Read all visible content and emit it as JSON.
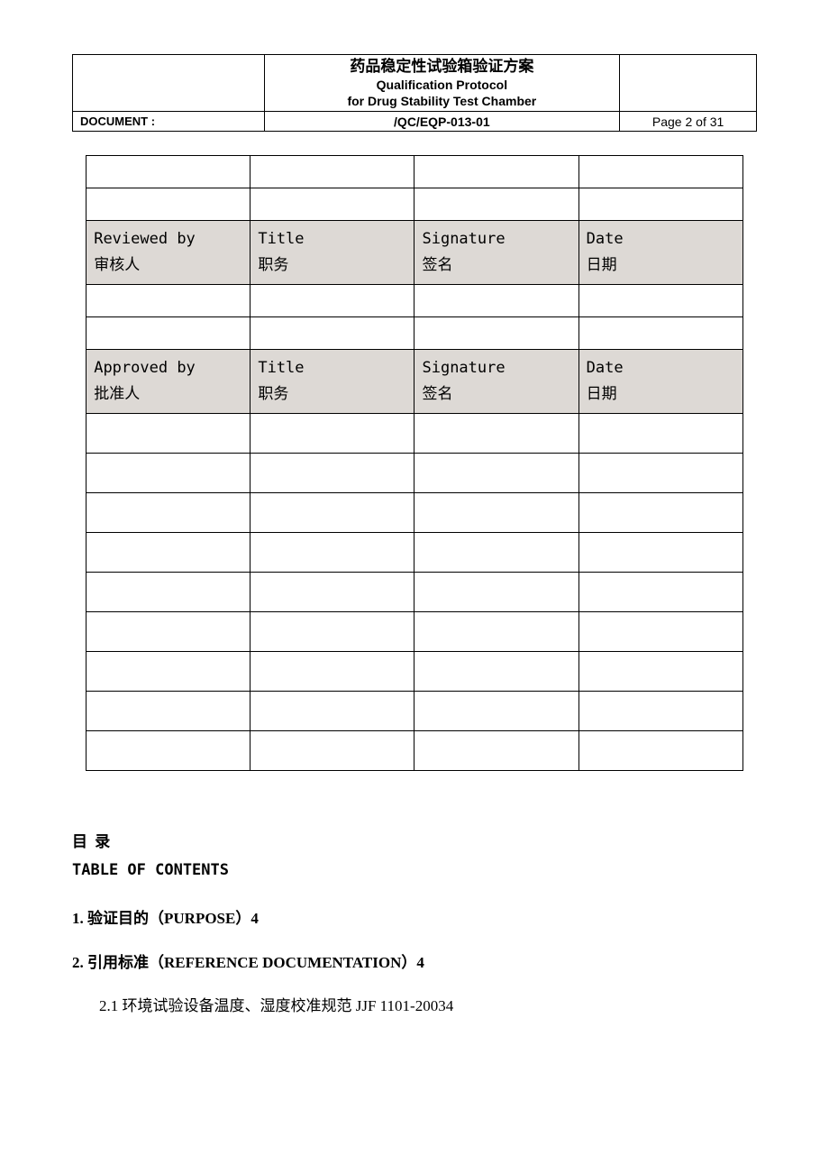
{
  "header": {
    "title_cn": "药品稳定性试验箱验证方案",
    "title_en1": "Qualification Protocol",
    "title_en2": "for Drug Stability Test Chamber",
    "doc_label": "DOCUMENT :",
    "doc_number": "/QC/EQP-013-01",
    "page_info": "Page 2 of 31"
  },
  "signoff": {
    "reviewed": {
      "c1_en": "Reviewed by",
      "c1_cn": "审核人",
      "c2_en": "Title",
      "c2_cn": "职务",
      "c3_en": "Signature",
      "c3_cn": "签名",
      "c4_en": "Date",
      "c4_cn": "日期"
    },
    "approved": {
      "c1_en": "Approved by",
      "c1_cn": "批准人",
      "c2_en": "Title",
      "c2_cn": "职务",
      "c3_en": "Signature",
      "c3_cn": "签名",
      "c4_en": "Date",
      "c4_cn": "日期"
    }
  },
  "toc": {
    "heading_cn": "目  录",
    "heading_en": "TABLE OF CONTENTS",
    "item1": "1. 验证目的（PURPOSE）4",
    "item2": "2. 引用标准（REFERENCE DOCUMENTATION）4",
    "item2_1": "2.1 环境试验设备温度、湿度校准规范 JJF 1101-20034"
  }
}
